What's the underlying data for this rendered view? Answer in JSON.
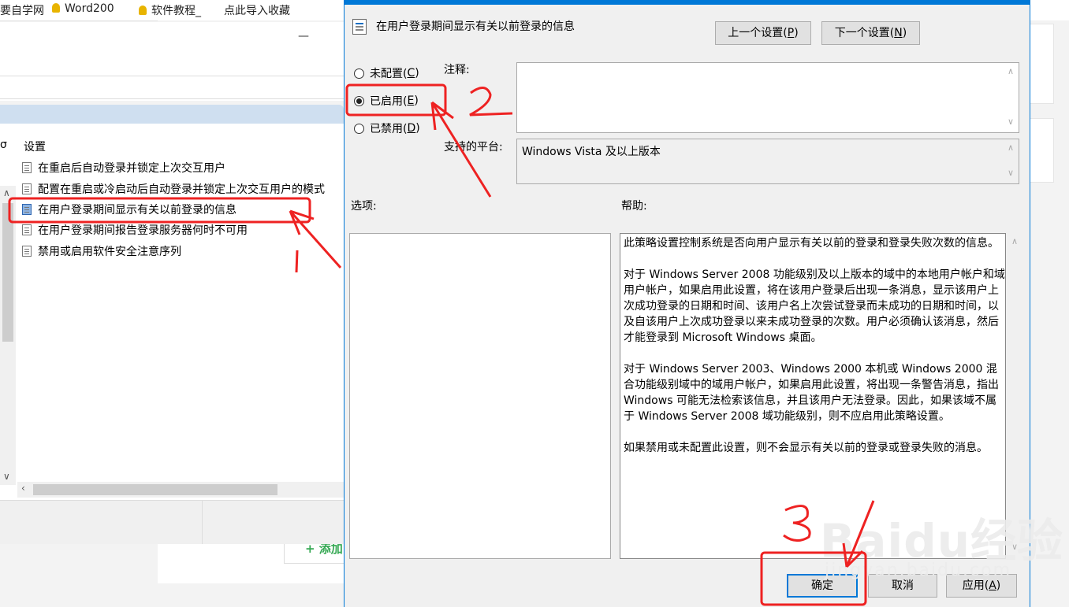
{
  "bookmarks": [
    {
      "label": "要自学网",
      "icon": false
    },
    {
      "label": "Word200",
      "icon": true
    },
    {
      "label": "软件教程_",
      "icon": true
    },
    {
      "label": "点此导入收藏",
      "icon": false
    }
  ],
  "background_page": {
    "add_button": "+ 添加"
  },
  "gpe": {
    "minimize_glyph": "—",
    "column_left": "σ",
    "column_header": "设置",
    "items": [
      "在重启后自动登录并锁定上次交互用户",
      "配置在重启或冷启动后自动登录并锁定上次交互用户的模式",
      "在用户登录期间显示有关以前登录的信息",
      "在用户登录期间报告登录服务器何时不可用",
      "禁用或启用软件安全注意序列"
    ],
    "selected_index": 2
  },
  "dialog": {
    "title": "在用户登录期间显示有关以前登录的信息",
    "prev_button": {
      "text": "上一个设置(",
      "key": "P",
      "end": ")"
    },
    "next_button": {
      "text": "下一个设置(",
      "key": "N",
      "end": ")"
    },
    "radios": [
      {
        "text": "未配置(",
        "key": "C",
        "end": ")",
        "checked": false
      },
      {
        "text": "已启用(",
        "key": "E",
        "end": ")",
        "checked": true
      },
      {
        "text": "已禁用(",
        "key": "D",
        "end": ")",
        "checked": false
      }
    ],
    "comment_label": "注释:",
    "comment_value": "",
    "platform_label": "支持的平台:",
    "platform_value": "Windows Vista 及以上版本",
    "options_label": "选项:",
    "help_label": "帮助:",
    "help_paragraphs": [
      "此策略设置控制系统是否向用户显示有关以前的登录和登录失败次数的信息。",
      "对于 Windows Server 2008 功能级别及以上版本的域中的本地用户帐户和域用户帐户，如果启用此设置，将在该用户登录后出现一条消息，显示该用户上次成功登录的日期和时间、该用户名上次尝试登录而未成功的日期和时间，以及自该用户上次成功登录以来未成功登录的次数。用户必须确认该消息，然后才能登录到 Microsoft Windows 桌面。",
      "对于 Windows Server 2003、Windows 2000 本机或 Windows 2000 混合功能级别域中的域用户帐户，如果启用此设置，将出现一条警告消息，指出 Windows 可能无法检索该信息，并且该用户无法登录。因此，如果该域不属于 Windows Server 2008 域功能级别，则不应启用此策略设置。",
      "如果禁用或未配置此设置，则不会显示有关以前的登录或登录失败的消息。"
    ],
    "ok_button": "确定",
    "cancel_button": "取消",
    "apply_button": {
      "text": "应用(",
      "key": "A",
      "end": ")"
    }
  },
  "annotations": {
    "step1": "1",
    "step2": "2",
    "step3": "3",
    "color": "#ee2222"
  },
  "watermark": {
    "main": "Baidu经验",
    "sub": "jingyan.baidu.com"
  }
}
